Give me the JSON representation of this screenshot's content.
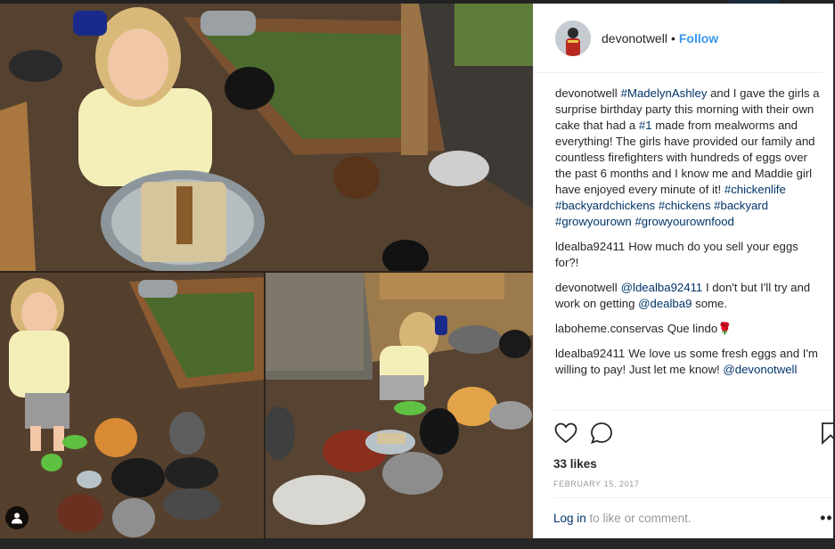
{
  "post": {
    "username": "devonotwell",
    "follow_label": "Follow",
    "separator": "•"
  },
  "comments": [
    {
      "user": "devonotwell",
      "parts": [
        {
          "t": "link",
          "v": "#MadelynAshley"
        },
        {
          "t": "text",
          "v": " and I gave the girls a surprise birthday party this morning with their own cake that had a "
        },
        {
          "t": "link",
          "v": "#1"
        },
        {
          "t": "text",
          "v": " made from mealworms and everything! The girls have provided our family and countless firefighters with hundreds of eggs over the past 6 months and I know me and Maddie girl have enjoyed every minute of it! "
        },
        {
          "t": "link",
          "v": "#chickenlife"
        },
        {
          "t": "text",
          "v": " "
        },
        {
          "t": "link",
          "v": "#backyardchickens"
        },
        {
          "t": "text",
          "v": " "
        },
        {
          "t": "link",
          "v": "#chickens"
        },
        {
          "t": "text",
          "v": " "
        },
        {
          "t": "link",
          "v": "#backyard"
        },
        {
          "t": "text",
          "v": " "
        },
        {
          "t": "link",
          "v": "#growyourown"
        },
        {
          "t": "text",
          "v": " "
        },
        {
          "t": "link",
          "v": "#growyourownfood"
        }
      ]
    },
    {
      "user": "ldealba92411",
      "parts": [
        {
          "t": "text",
          "v": "How much do you sell your eggs for?!"
        }
      ]
    },
    {
      "user": "devonotwell",
      "parts": [
        {
          "t": "link",
          "v": "@ldealba92411"
        },
        {
          "t": "text",
          "v": " I don't but I'll try and work on getting "
        },
        {
          "t": "link",
          "v": "@dealba9"
        },
        {
          "t": "text",
          "v": " some."
        }
      ]
    },
    {
      "user": "laboheme.conservas",
      "parts": [
        {
          "t": "text",
          "v": "Que lindo🌹"
        }
      ]
    },
    {
      "user": "ldealba92411",
      "parts": [
        {
          "t": "text",
          "v": "We love us some fresh eggs and I'm willing to pay! Just let me know! "
        },
        {
          "t": "link",
          "v": "@devonotwell"
        }
      ]
    }
  ],
  "actions": {
    "like_icon": "heart-icon",
    "comment_icon": "comment-bubble-icon",
    "save_icon": "bookmark-icon"
  },
  "likes": "33 likes",
  "date": "FEBRUARY 15, 2017",
  "login": {
    "link": "Log in",
    "rest": " to like or comment.",
    "more": "•••"
  },
  "colors": {
    "link": "#003569",
    "follow": "#3897f0",
    "muted": "#999999",
    "text": "#262626"
  }
}
